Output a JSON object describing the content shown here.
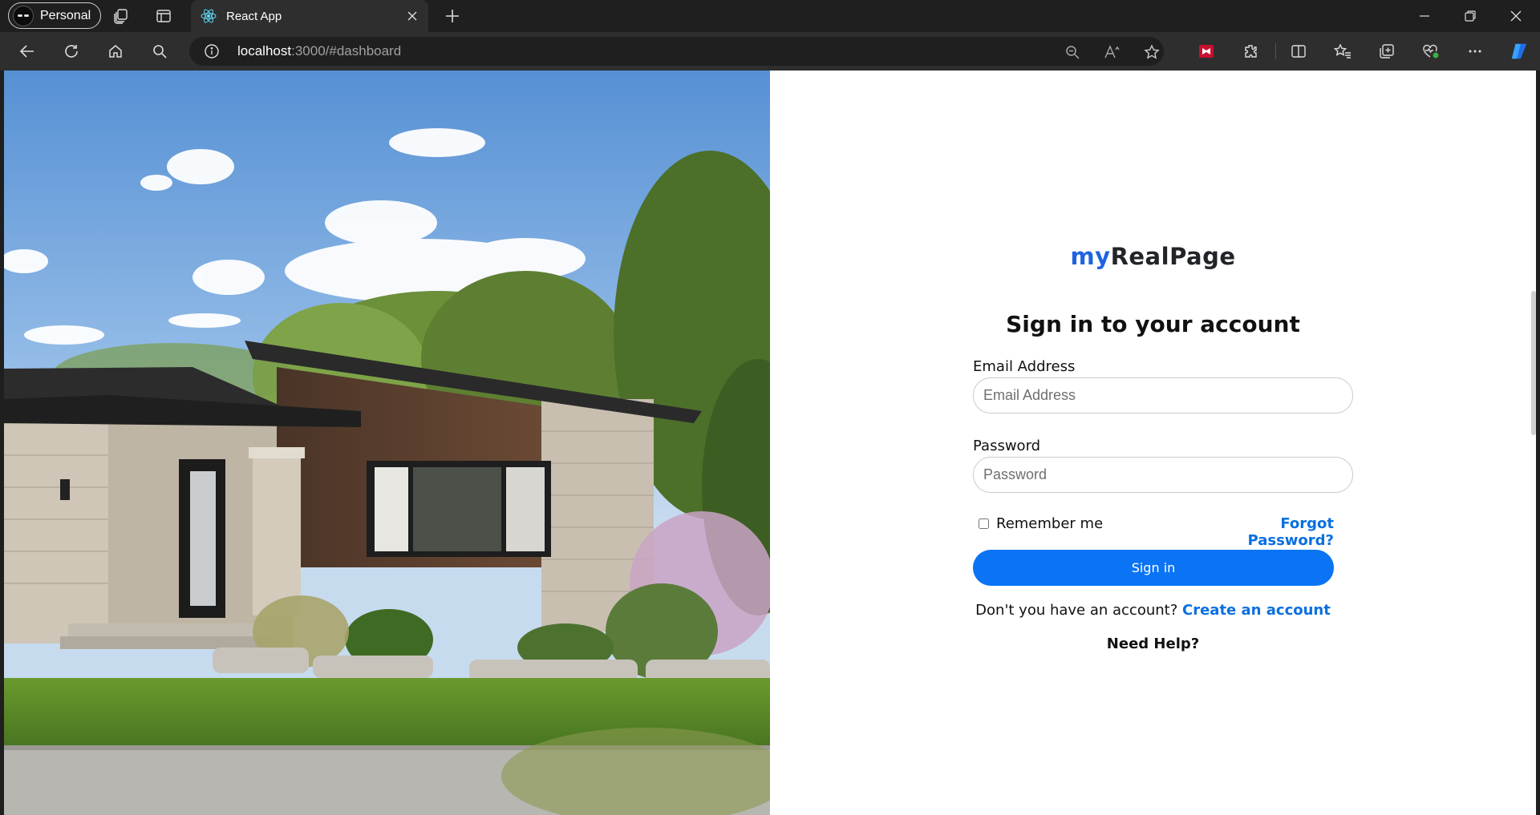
{
  "browser": {
    "profile_label": "Personal",
    "tab_title": "React App",
    "url_host": "localhost",
    "url_path": ":3000/#dashboard"
  },
  "login": {
    "logo_part1": "my",
    "logo_part2": "RealPage",
    "heading": "Sign in to your account",
    "email_label": "Email Address",
    "email_placeholder": "Email Address",
    "password_label": "Password",
    "password_placeholder": "Password",
    "remember_label": "Remember me",
    "forgot_link": "Forgot Password?",
    "signin_button": "Sign in",
    "no_account_text": "Don't you have an account? ",
    "create_account_link": "Create an account",
    "help_link": "Need Help?"
  },
  "colors": {
    "accent": "#0a74f5",
    "link": "#0a6fe0",
    "logo_blue": "#1e64e0"
  }
}
